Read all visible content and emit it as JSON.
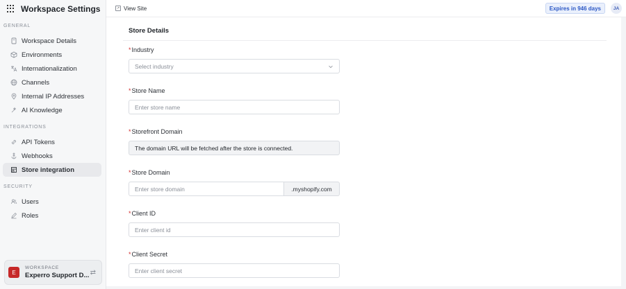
{
  "sidebar": {
    "title": "Workspace Settings",
    "sections": {
      "general": "GENERAL",
      "integrations": "INTEGRATIONS",
      "security": "SECURITY"
    },
    "items": [
      {
        "label": "Workspace Details",
        "icon": "document-icon"
      },
      {
        "label": "Environments",
        "icon": "cube-icon"
      },
      {
        "label": "Internationalization",
        "icon": "translate-icon"
      },
      {
        "label": "Channels",
        "icon": "globe-icon"
      },
      {
        "label": "Internal IP Addresses",
        "icon": "location-pin-icon"
      },
      {
        "label": "AI Knowledge",
        "icon": "sparkle-icon"
      },
      {
        "label": "API Tokens",
        "icon": "link-icon"
      },
      {
        "label": "Webhooks",
        "icon": "anchor-icon"
      },
      {
        "label": "Store integration",
        "icon": "store-icon",
        "active": true
      },
      {
        "label": "Users",
        "icon": "users-icon"
      },
      {
        "label": "Roles",
        "icon": "pen-icon"
      }
    ],
    "workspace": {
      "label": "WORKSPACE",
      "name": "Experro Support D...",
      "initial": "E"
    }
  },
  "topbar": {
    "view_site": "View Site",
    "expiry": "Expires in 946 days",
    "user_initials": "JA"
  },
  "form": {
    "section_title": "Store Details",
    "required_marker": "*",
    "industry": {
      "label": "Industry",
      "placeholder": "Select industry"
    },
    "store_name": {
      "label": "Store Name",
      "placeholder": "Enter store name"
    },
    "storefront_domain": {
      "label": "Storefront Domain",
      "value": "The domain URL will be fetched after the store is connected."
    },
    "store_domain": {
      "label": "Store Domain",
      "placeholder": "Enter store domain",
      "suffix": ".myshopify.com"
    },
    "client_id": {
      "label": "Client ID",
      "placeholder": "Enter client id"
    },
    "client_secret": {
      "label": "Client Secret",
      "placeholder": "Enter client secret"
    }
  },
  "colors": {
    "accent": "#2b57c5",
    "required": "#d32f2f",
    "workspace_avatar": "#c62828"
  }
}
